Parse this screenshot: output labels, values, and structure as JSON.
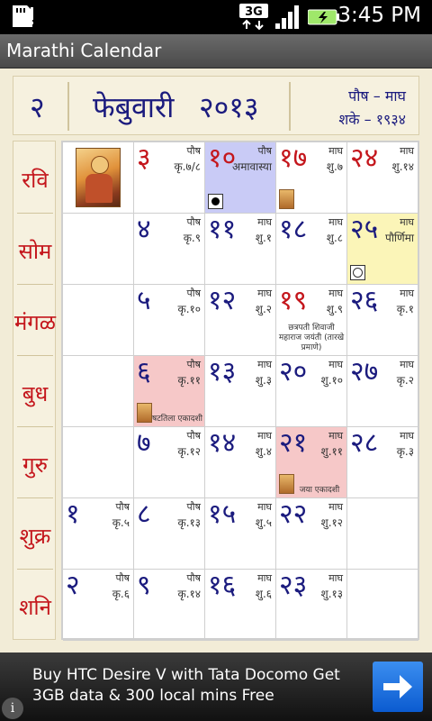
{
  "status_bar": {
    "time": "3:45 PM",
    "network": "3G"
  },
  "app": {
    "title": "Marathi Calendar"
  },
  "header": {
    "week_num": "२",
    "month": "फेबुवारी",
    "year": "२०१३",
    "maas": "पौष – माघ",
    "shake": "शके – १९३४"
  },
  "days": [
    "रवि",
    "सोम",
    "मंगळ",
    "बुध",
    "गुरु",
    "शुक्र",
    "शनि"
  ],
  "grid": [
    [
      {
        "kind": "portrait",
        "name": "calendar-portrait"
      },
      {
        "num": "३",
        "month": "पौष",
        "tithi": "कृ.७/८",
        "red": true
      },
      {
        "num": "१०",
        "month": "पौष",
        "tithi": "अमावास्या",
        "red": true,
        "style": "amavasya",
        "moon": "new"
      },
      {
        "num": "१७",
        "month": "माघ",
        "tithi": "शु.७",
        "red": true,
        "thumb": true
      },
      {
        "num": "२४",
        "month": "माघ",
        "tithi": "शु.१४",
        "red": true
      }
    ],
    [
      {
        "kind": "empty"
      },
      {
        "num": "४",
        "month": "पौष",
        "tithi": "कृ.९"
      },
      {
        "num": "११",
        "month": "माघ",
        "tithi": "शु.१"
      },
      {
        "num": "१८",
        "month": "माघ",
        "tithi": "शु.८"
      },
      {
        "num": "२५",
        "month": "माघ",
        "tithi": "पौर्णिमा",
        "style": "purnima",
        "moon": "full"
      }
    ],
    [
      {
        "kind": "empty"
      },
      {
        "num": "५",
        "month": "पौष",
        "tithi": "कृ.१०"
      },
      {
        "num": "१२",
        "month": "माघ",
        "tithi": "शु.२"
      },
      {
        "num": "१९",
        "month": "माघ",
        "tithi": "शु.९",
        "red": true,
        "note": "छत्रपती शिवाजी महाराज जयंती (तारखे प्रमाणे)"
      },
      {
        "num": "२६",
        "month": "माघ",
        "tithi": "कृ.१"
      }
    ],
    [
      {
        "kind": "empty"
      },
      {
        "num": "६",
        "month": "पौष",
        "tithi": "कृ.११",
        "style": "ekadashi",
        "thumb": true,
        "note": "षटतिला एकादशी"
      },
      {
        "num": "१३",
        "month": "माघ",
        "tithi": "शु.३"
      },
      {
        "num": "२०",
        "month": "माघ",
        "tithi": "शु.१०"
      },
      {
        "num": "२७",
        "month": "माघ",
        "tithi": "कृ.२"
      }
    ],
    [
      {
        "kind": "empty"
      },
      {
        "num": "७",
        "month": "पौष",
        "tithi": "कृ.१२"
      },
      {
        "num": "१४",
        "month": "माघ",
        "tithi": "शु.४"
      },
      {
        "num": "२१",
        "month": "माघ",
        "tithi": "शु.११",
        "style": "ekadashi",
        "thumb": true,
        "note": "जया एकादशी"
      },
      {
        "num": "२८",
        "month": "माघ",
        "tithi": "कृ.३"
      }
    ],
    [
      {
        "num": "१",
        "month": "पौष",
        "tithi": "कृ.५"
      },
      {
        "num": "८",
        "month": "पौष",
        "tithi": "कृ.१३"
      },
      {
        "num": "१५",
        "month": "माघ",
        "tithi": "शु.५"
      },
      {
        "num": "२२",
        "month": "माघ",
        "tithi": "शु.१२"
      },
      {
        "kind": "empty"
      }
    ],
    [
      {
        "num": "२",
        "month": "पौष",
        "tithi": "कृ.६"
      },
      {
        "num": "९",
        "month": "पौष",
        "tithi": "कृ.१४"
      },
      {
        "num": "१६",
        "month": "माघ",
        "tithi": "शु.६"
      },
      {
        "num": "२३",
        "month": "माघ",
        "tithi": "शु.१३"
      },
      {
        "kind": "empty"
      }
    ]
  ],
  "ad": {
    "text": "Buy HTC Desire V with Tata Docomo Get 3GB data & 300 local mins Free",
    "info": "i"
  },
  "colors": {
    "accent_blue": "#1b1b7e",
    "holiday_red": "#c4161c",
    "amavasya": "#c9cbf6",
    "purnima": "#fbf5b8",
    "ekadashi": "#f6c8c8"
  }
}
